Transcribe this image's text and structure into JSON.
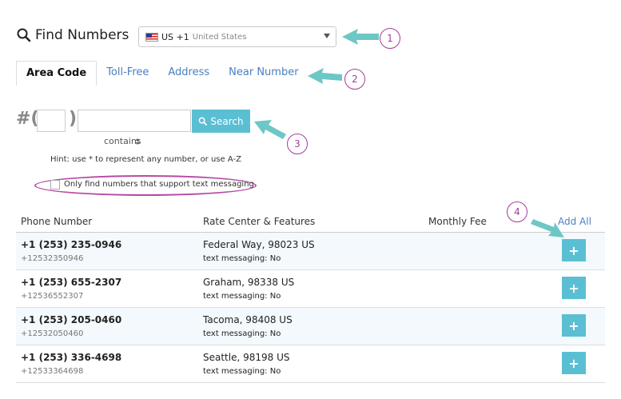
{
  "header": {
    "title": "Find Numbers"
  },
  "country_select": {
    "code": "US +1",
    "name": "United States"
  },
  "tabs": [
    {
      "label": "Area Code",
      "active": true
    },
    {
      "label": "Toll-Free",
      "active": false
    },
    {
      "label": "Address",
      "active": false
    },
    {
      "label": "Near Number",
      "active": false
    }
  ],
  "search": {
    "hash": "#(",
    "paren_close": ")",
    "button_label": "Search",
    "match_mode": "contains",
    "hint": "Hint: use * to represent any number, or use A-Z",
    "sms_only_label": "Only find numbers that support text messaging"
  },
  "table": {
    "columns": [
      "Phone Number",
      "Rate Center & Features",
      "Monthly Fee"
    ],
    "add_all_label": "Add All",
    "rows": [
      {
        "phone": "+1 (253) 235-0946",
        "raw": "+12532350946",
        "rate_center": "Federal Way, 98023 US",
        "features": "text messaging: No"
      },
      {
        "phone": "+1 (253) 655-2307",
        "raw": "+12536552307",
        "rate_center": "Graham, 98338 US",
        "features": "text messaging: No"
      },
      {
        "phone": "+1 (253) 205-0460",
        "raw": "+12532050460",
        "rate_center": "Tacoma, 98408 US",
        "features": "text messaging: No"
      },
      {
        "phone": "+1 (253) 336-4698",
        "raw": "+12533364698",
        "rate_center": "Seattle, 98198 US",
        "features": "text messaging: No"
      }
    ],
    "add_label": "+"
  },
  "callouts": [
    "1",
    "2",
    "3",
    "4"
  ],
  "colors": {
    "accent": "#5bbfd3",
    "link": "#4a7fc1",
    "callout": "#a43d9e",
    "arrow": "#6cc7c5"
  }
}
